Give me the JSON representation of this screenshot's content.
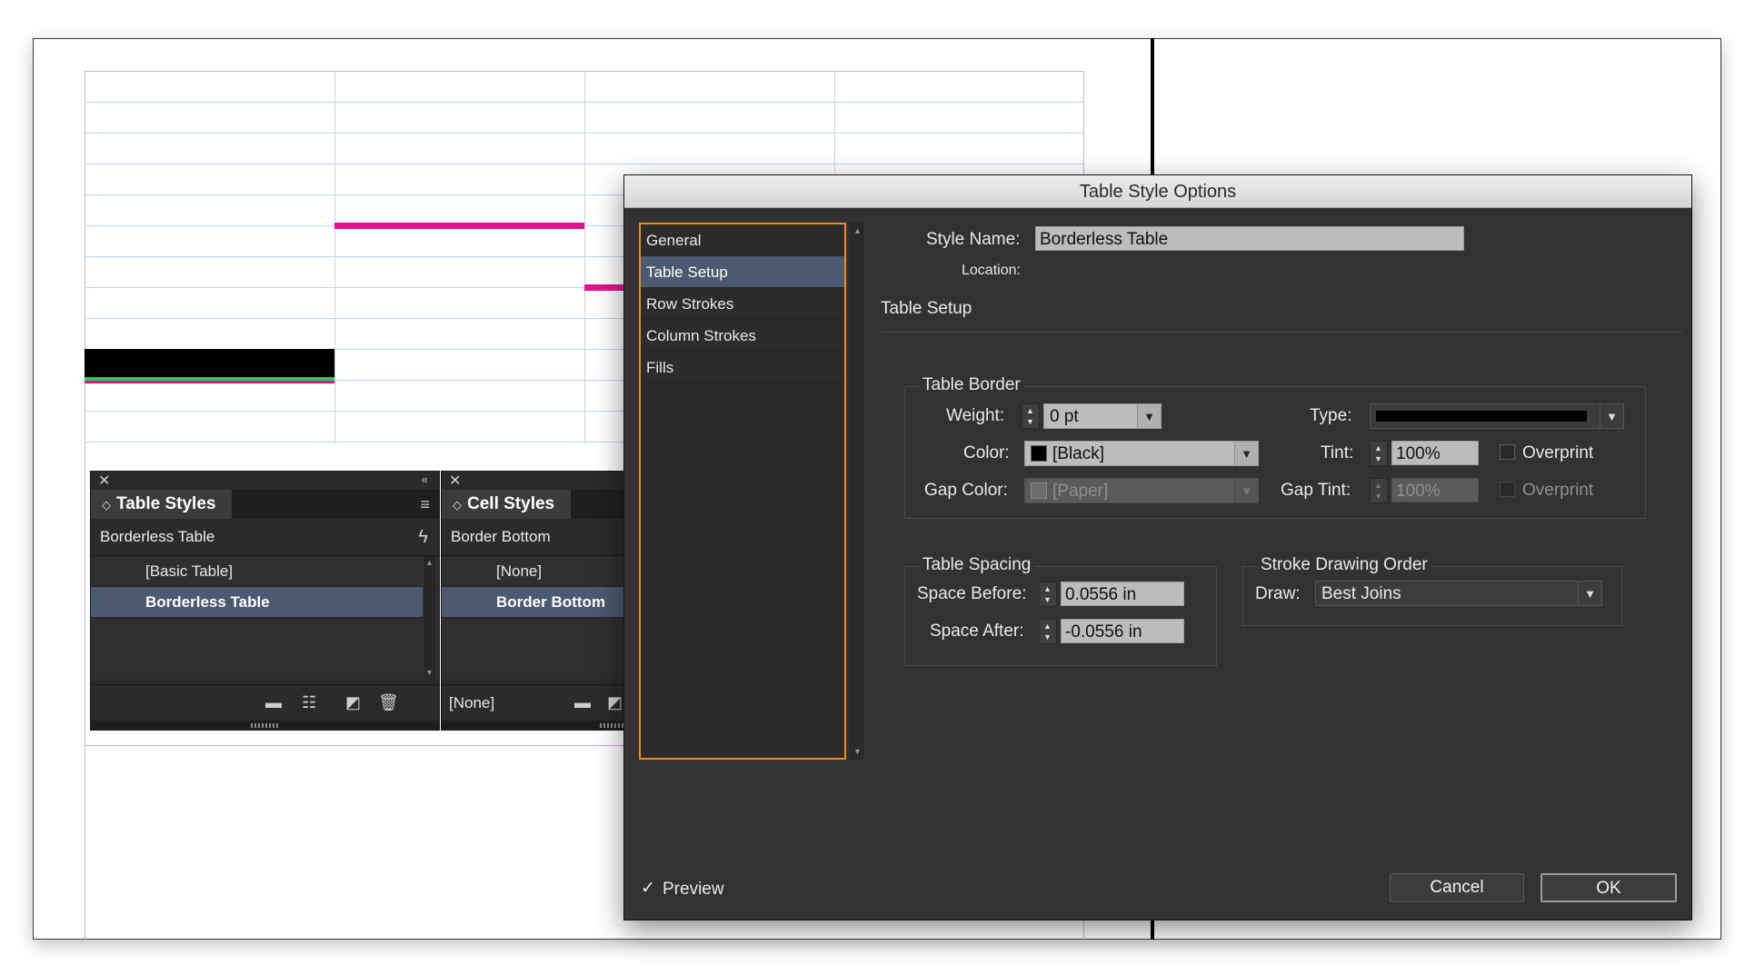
{
  "table_styles_panel": {
    "tab_label": "Table Styles",
    "current_style": "Borderless Table",
    "items": [
      {
        "label": "[Basic Table]",
        "selected": false
      },
      {
        "label": "Borderless Table",
        "selected": true
      }
    ]
  },
  "cell_styles_panel": {
    "tab_label": "Cell Styles",
    "current_style": "Border Bottom",
    "items": [
      {
        "label": "[None]",
        "selected": false
      },
      {
        "label": "Border Bottom",
        "selected": true
      }
    ],
    "footer_value": "[None]"
  },
  "dialog": {
    "title": "Table Style Options",
    "nav": [
      {
        "label": "General",
        "selected": false
      },
      {
        "label": "Table Setup",
        "selected": true
      },
      {
        "label": "Row Strokes",
        "selected": false
      },
      {
        "label": "Column Strokes",
        "selected": false
      },
      {
        "label": "Fills",
        "selected": false
      }
    ],
    "style_name_label": "Style Name:",
    "style_name_value": "Borderless Table",
    "location_label": "Location:",
    "section_title": "Table Setup",
    "table_border": {
      "title": "Table Border",
      "weight_label": "Weight:",
      "weight_value": "0 pt",
      "type_label": "Type:",
      "color_label": "Color:",
      "color_value": "[Black]",
      "tint_label": "Tint:",
      "tint_value": "100%",
      "overprint_label": "Overprint",
      "gap_color_label": "Gap Color:",
      "gap_color_value": "[Paper]",
      "gap_tint_label": "Gap Tint:",
      "gap_tint_value": "100%",
      "gap_overprint_label": "Overprint"
    },
    "table_spacing": {
      "title": "Table Spacing",
      "space_before_label": "Space Before:",
      "space_before_value": "0.0556 in",
      "space_after_label": "Space After:",
      "space_after_value": "-0.0556 in"
    },
    "stroke_order": {
      "title": "Stroke Drawing Order",
      "draw_label": "Draw:",
      "draw_value": "Best Joins"
    },
    "preview_label": "Preview",
    "preview_checked": true,
    "cancel_label": "Cancel",
    "ok_label": "OK"
  },
  "colors": {
    "accent_focus": "#f08a1c",
    "selection": "#4b5a70",
    "stroke_pink": "#e3138e",
    "stroke_green": "#1fd05a"
  }
}
